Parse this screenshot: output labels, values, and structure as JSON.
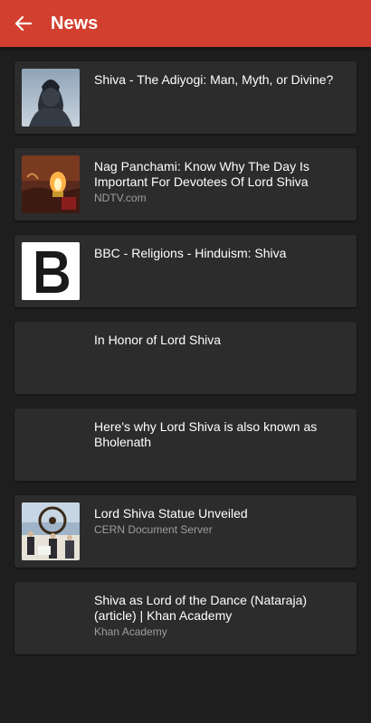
{
  "appbar": {
    "title": "News",
    "back_icon": "arrow-left-icon",
    "color": "#d23f2f"
  },
  "articles": [
    {
      "headline": "Shiva - The Adiyogi: Man, Myth, or Divine?",
      "source": "",
      "thumbnail": "adiyogi-statue-image"
    },
    {
      "headline": "Nag Panchami: Know Why The Day Is Important For Devotees Of Lord Shiva",
      "source": "NDTV.com",
      "thumbnail": "diya-lamp-image"
    },
    {
      "headline": "BBC - Religions - Hinduism: Shiva",
      "source": "",
      "thumbnail": "letter-b-logo"
    },
    {
      "headline": "In Honor of Lord Shiva",
      "source": "",
      "thumbnail": ""
    },
    {
      "headline": "Here's why Lord Shiva is also known as Bholenath",
      "source": "",
      "thumbnail": ""
    },
    {
      "headline": "Lord Shiva Statue Unveiled",
      "source": "CERN Document Server",
      "thumbnail": "cern-statue-image"
    },
    {
      "headline": "Shiva as Lord of the Dance (Nataraja) (article) | Khan Academy",
      "source": "Khan Academy",
      "thumbnail": ""
    }
  ]
}
